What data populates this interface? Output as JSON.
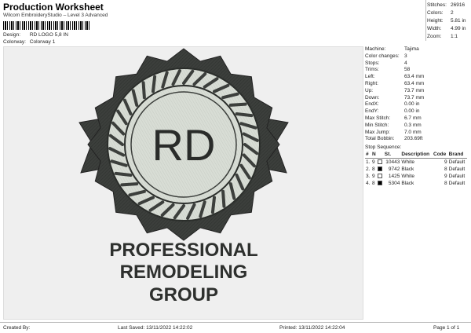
{
  "header": {
    "title": "Production Worksheet",
    "subtitle": "Wilcom EmbroideryStudio – Level 3 Advanced",
    "design_label": "Design:",
    "design_value": "RD LOGO 5,8 IN",
    "colorway_label": "Colorway:",
    "colorway_value": "Colorway 1"
  },
  "stats": [
    {
      "label": "Stitches:",
      "value": "26916"
    },
    {
      "label": "Colors:",
      "value": "2"
    },
    {
      "label": "Height:",
      "value": "5.81 in"
    },
    {
      "label": "Width:",
      "value": "4.99 in"
    },
    {
      "label": "Zoom:",
      "value": "1:1"
    }
  ],
  "machine_info": [
    {
      "label": "Machine:",
      "value": "Tajima"
    },
    {
      "label": "Color changes:",
      "value": "3"
    },
    {
      "label": "Stops:",
      "value": "4"
    },
    {
      "label": "Trims:",
      "value": "58"
    },
    {
      "label": "Left:",
      "value": "63.4 mm"
    },
    {
      "label": "Right:",
      "value": "63.4 mm"
    },
    {
      "label": "Up:",
      "value": "73.7 mm"
    },
    {
      "label": "Down:",
      "value": "73.7 mm"
    },
    {
      "label": "EndX:",
      "value": "0.00 in"
    },
    {
      "label": "EndY:",
      "value": "0.00 in"
    },
    {
      "label": "Max Stitch:",
      "value": "6.7 mm"
    },
    {
      "label": "Min Stitch:",
      "value": "0.3 mm"
    },
    {
      "label": "Max Jump:",
      "value": "7.0 mm"
    },
    {
      "label": "Total Bobbin:",
      "value": "203.69ft"
    }
  ],
  "stop_sequence": {
    "title": "Stop Sequence:",
    "headers": [
      "#",
      "N",
      "",
      "St.",
      "Description",
      "Code",
      "Brand"
    ],
    "rows": [
      {
        "idx": "1.",
        "n": "9",
        "color": "#ffffff",
        "st": "10443",
        "desc": "White",
        "code": "9",
        "brand": "Default"
      },
      {
        "idx": "2.",
        "n": "8",
        "color": "#000000",
        "st": "9742",
        "desc": "Black",
        "code": "8",
        "brand": "Default"
      },
      {
        "idx": "3.",
        "n": "9",
        "color": "#ffffff",
        "st": "1425",
        "desc": "White",
        "code": "9",
        "brand": "Default"
      },
      {
        "idx": "4.",
        "n": "8",
        "color": "#000000",
        "st": "5304",
        "desc": "Black",
        "code": "8",
        "brand": "Default"
      }
    ]
  },
  "design": {
    "monogram": "RD",
    "line1": "PROFESSIONAL",
    "line2": "REMODELING",
    "line3": "GROUP",
    "colors": {
      "dark": "#3c3f3c",
      "light": "#d8ddd5",
      "background": "#efefef"
    }
  },
  "footer": {
    "created_by": "Created By:",
    "last_saved": "Last Saved: 13/11/2022 14:22:02",
    "printed": "Printed: 13/11/2022 14:22:04",
    "page": "Page 1 of 1"
  }
}
